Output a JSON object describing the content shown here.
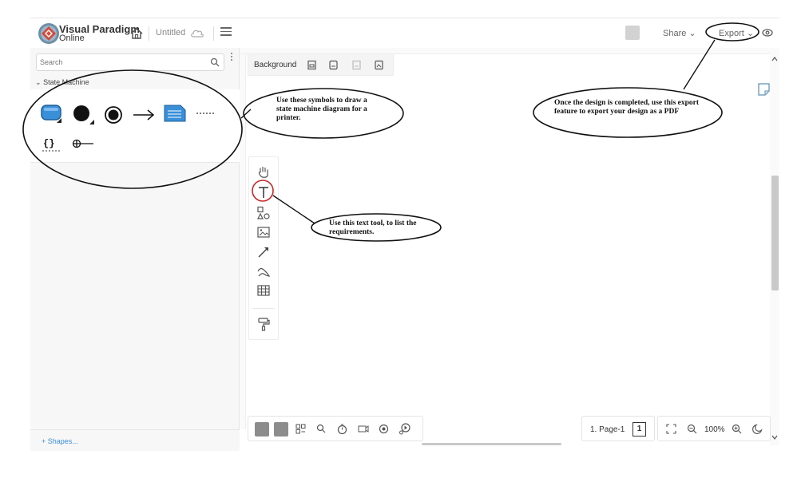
{
  "header": {
    "brand_line1": "Visual Paradigm",
    "brand_line2": "Online",
    "document_title": "Untitled",
    "share_label": "Share",
    "export_label": "Export"
  },
  "sidebar": {
    "search_placeholder": "Search",
    "section_title": "State Machine",
    "shapes_link": "+ Shapes..."
  },
  "canvas": {
    "background_label": "Background"
  },
  "bottom_bar": {
    "page_label": "1. Page-1",
    "page_count": "1",
    "zoom_level": "100%"
  },
  "annotations": {
    "symbols_note": "Use these symbols to draw a state machine diagram for a printer.",
    "export_note": "Once the design is completed, use this export feature to export your design as a PDF",
    "text_tool_note": "Use this text tool, to list the requirements."
  },
  "colors": {
    "accent_blue": "#3a8fd9",
    "annotation_red": "#c62828"
  }
}
